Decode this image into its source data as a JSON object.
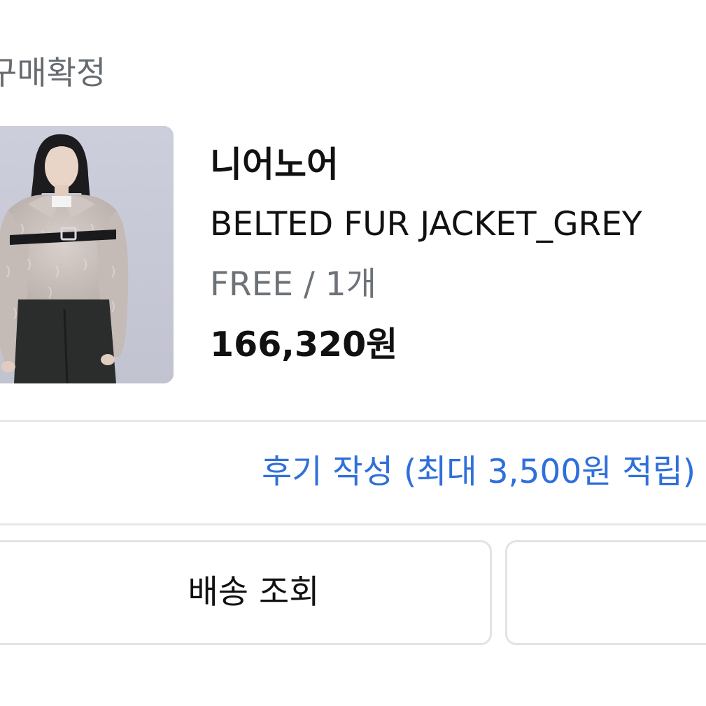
{
  "order": {
    "status": "구매확정"
  },
  "product": {
    "brand": "니어노어",
    "name": "BELTED FUR JACKET_GREY",
    "option": "FREE / 1개",
    "price": "166,320원",
    "image_alt": "product-photo"
  },
  "review": {
    "label": "후기 작성 (최대 3,500원 적립)"
  },
  "actions": {
    "shipping_label": "배송 조회",
    "second_label": ""
  },
  "colors": {
    "accent": "#2f6fdb",
    "text_primary": "#111111",
    "text_muted": "#6d7278",
    "divider": "#e6e7ea"
  }
}
